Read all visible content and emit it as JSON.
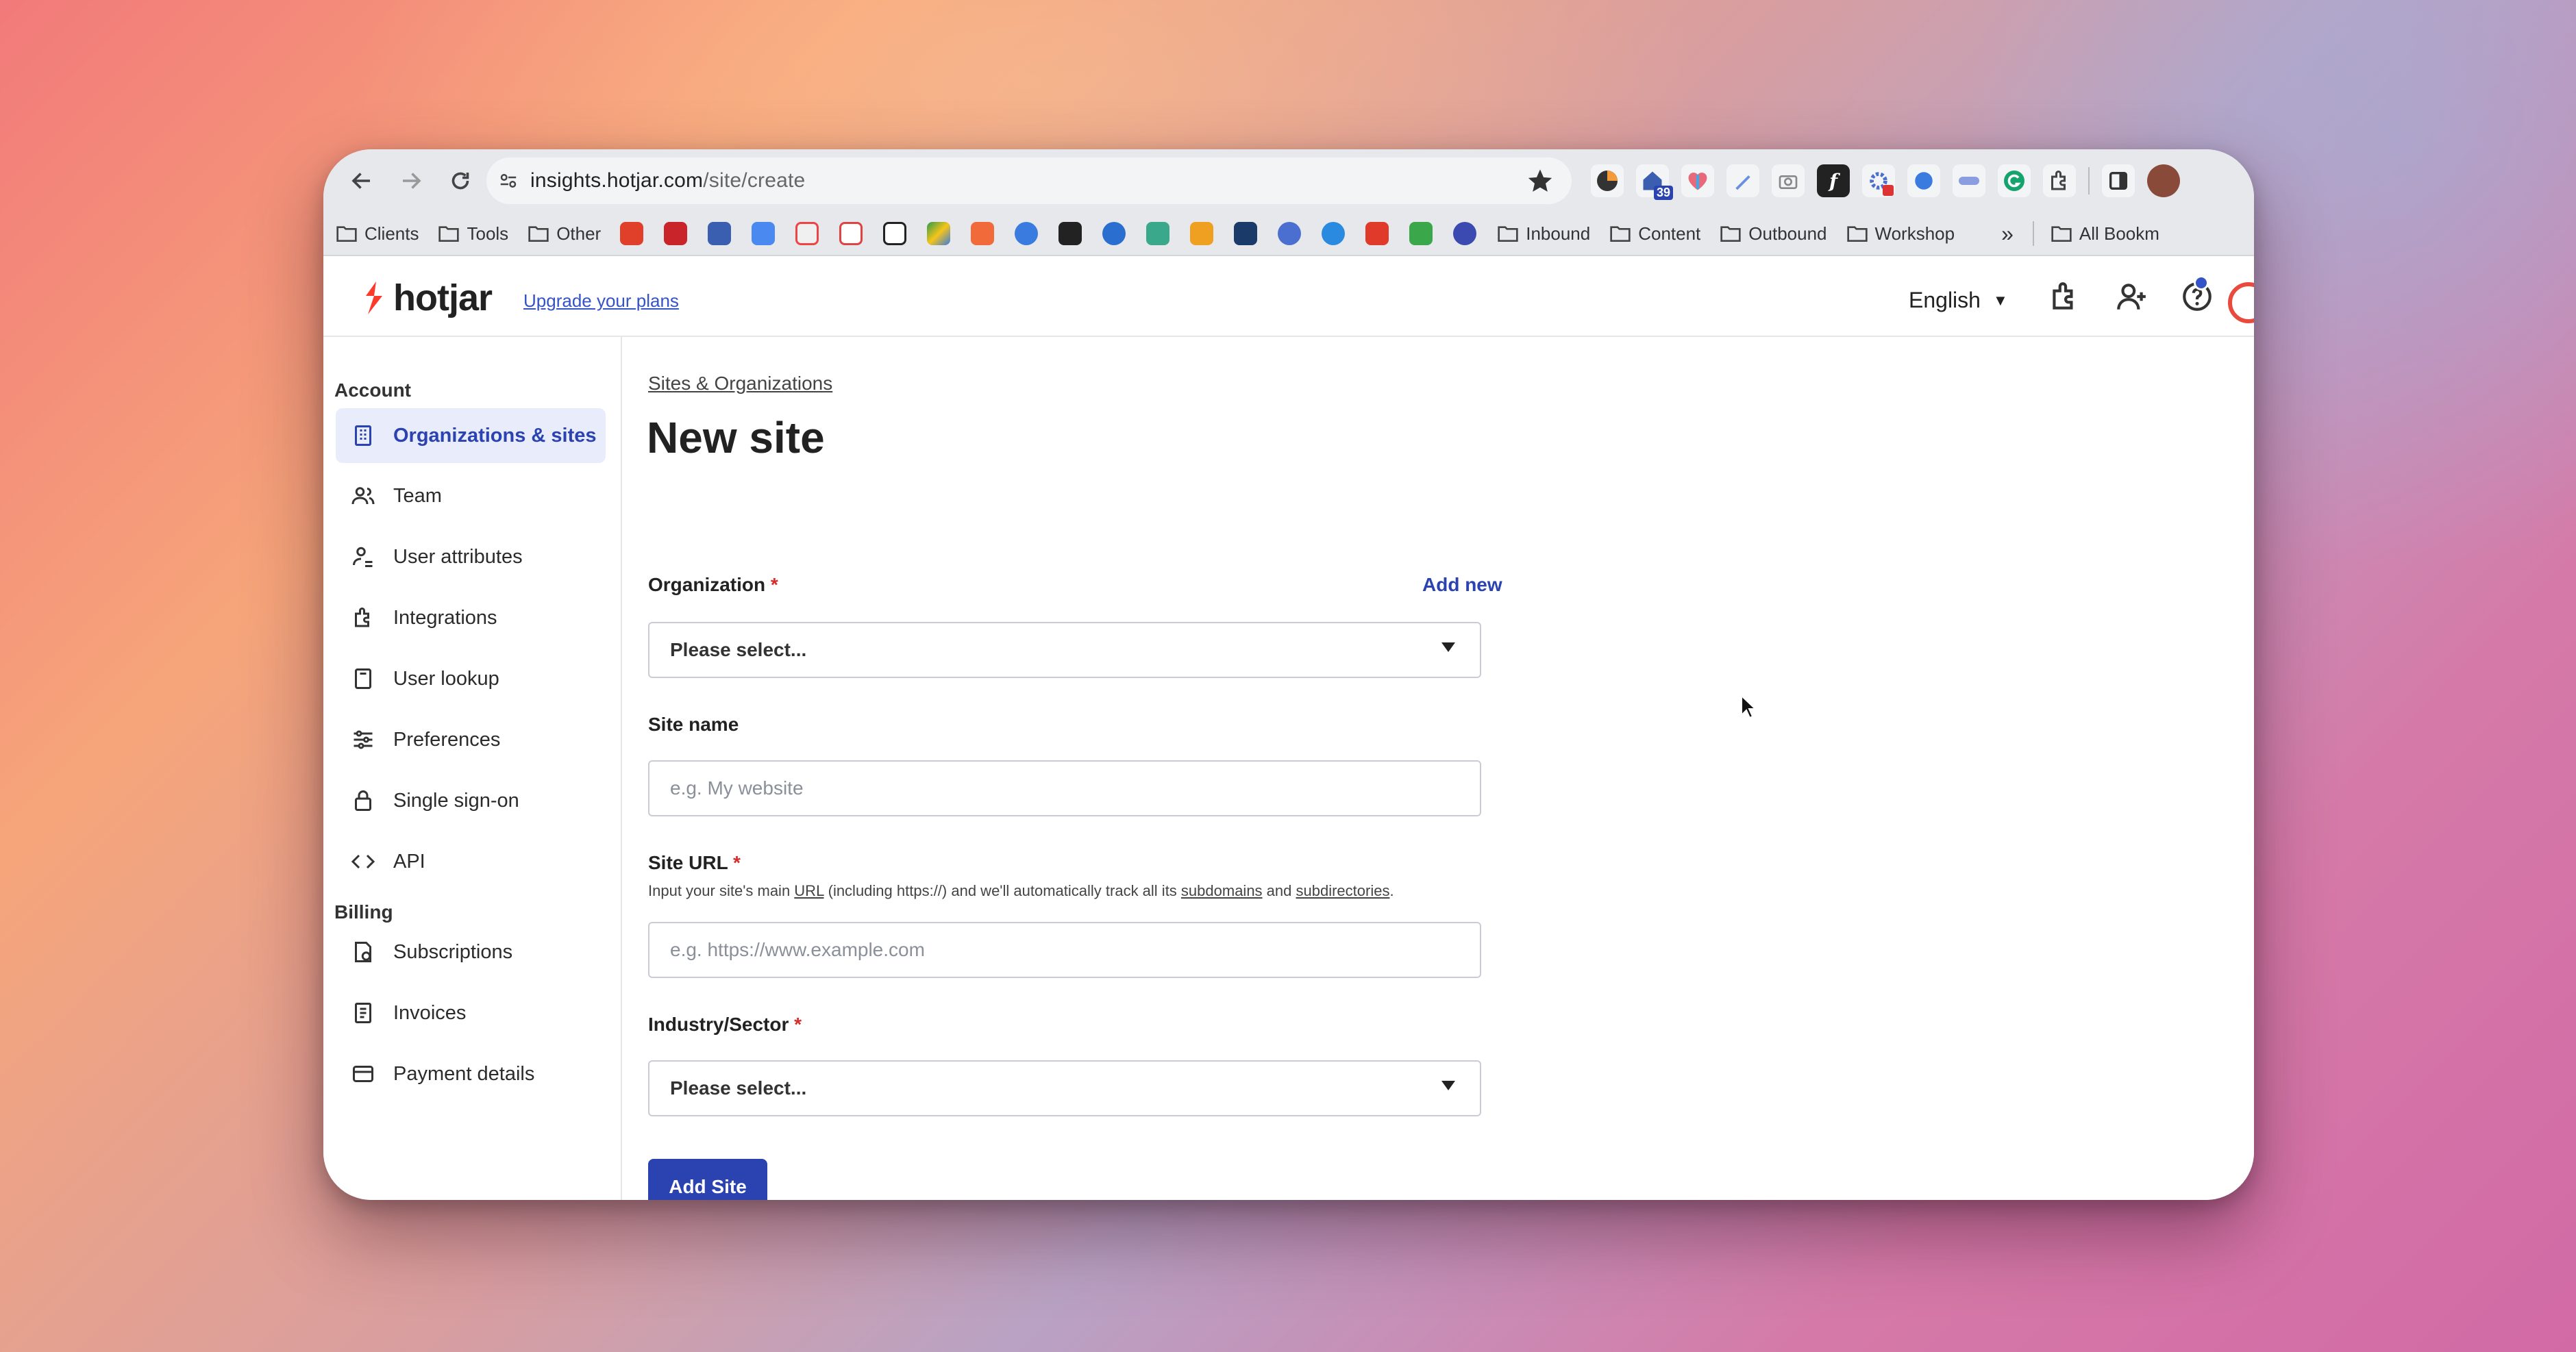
{
  "browser": {
    "url_host": "insights.hotjar.com",
    "url_path": "/site/create",
    "extension_badge": "39",
    "bookmarks": {
      "clients": "Clients",
      "tools": "Tools",
      "other": "Other",
      "inbound": "Inbound",
      "content": "Content",
      "outbound": "Outbound",
      "workshop": "Workshop",
      "more": "»",
      "all_bookmarks": "All Bookm"
    }
  },
  "header": {
    "logo_text": "hotjar",
    "upgrade_link": "Upgrade your plans",
    "language": "English"
  },
  "sidebar": {
    "account_title": "Account",
    "billing_title": "Billing",
    "account_items": [
      {
        "label": "Organizations & sites"
      },
      {
        "label": "Team"
      },
      {
        "label": "User attributes"
      },
      {
        "label": "Integrations"
      },
      {
        "label": "User lookup"
      },
      {
        "label": "Preferences"
      },
      {
        "label": "Single sign-on"
      },
      {
        "label": "API"
      }
    ],
    "billing_items": [
      {
        "label": "Subscriptions"
      },
      {
        "label": "Invoices"
      },
      {
        "label": "Payment details"
      }
    ]
  },
  "main": {
    "breadcrumb": "Sites & Organizations",
    "title": "New site",
    "organization": {
      "label": "Organization",
      "required_mark": "*",
      "add_new": "Add new",
      "value": "Please select..."
    },
    "site_name": {
      "label": "Site name",
      "placeholder": "e.g. My website"
    },
    "site_url": {
      "label": "Site URL",
      "required_mark": "*",
      "helper_1": "Input your site's main ",
      "helper_url": "URL",
      "helper_2": " (including https://) and we'll automatically track all its ",
      "helper_subdomains": "subdomains",
      "helper_3": " and ",
      "helper_subdirectories": "subdirectories",
      "helper_4": ".",
      "placeholder": "e.g. https://www.example.com"
    },
    "industry": {
      "label": "Industry/Sector",
      "required_mark": "*",
      "value": "Please select..."
    },
    "submit_label": "Add Site"
  },
  "colors": {
    "accent": "#2a43b0",
    "active_bg": "#e9ecfa",
    "required": "#d62c2c"
  }
}
